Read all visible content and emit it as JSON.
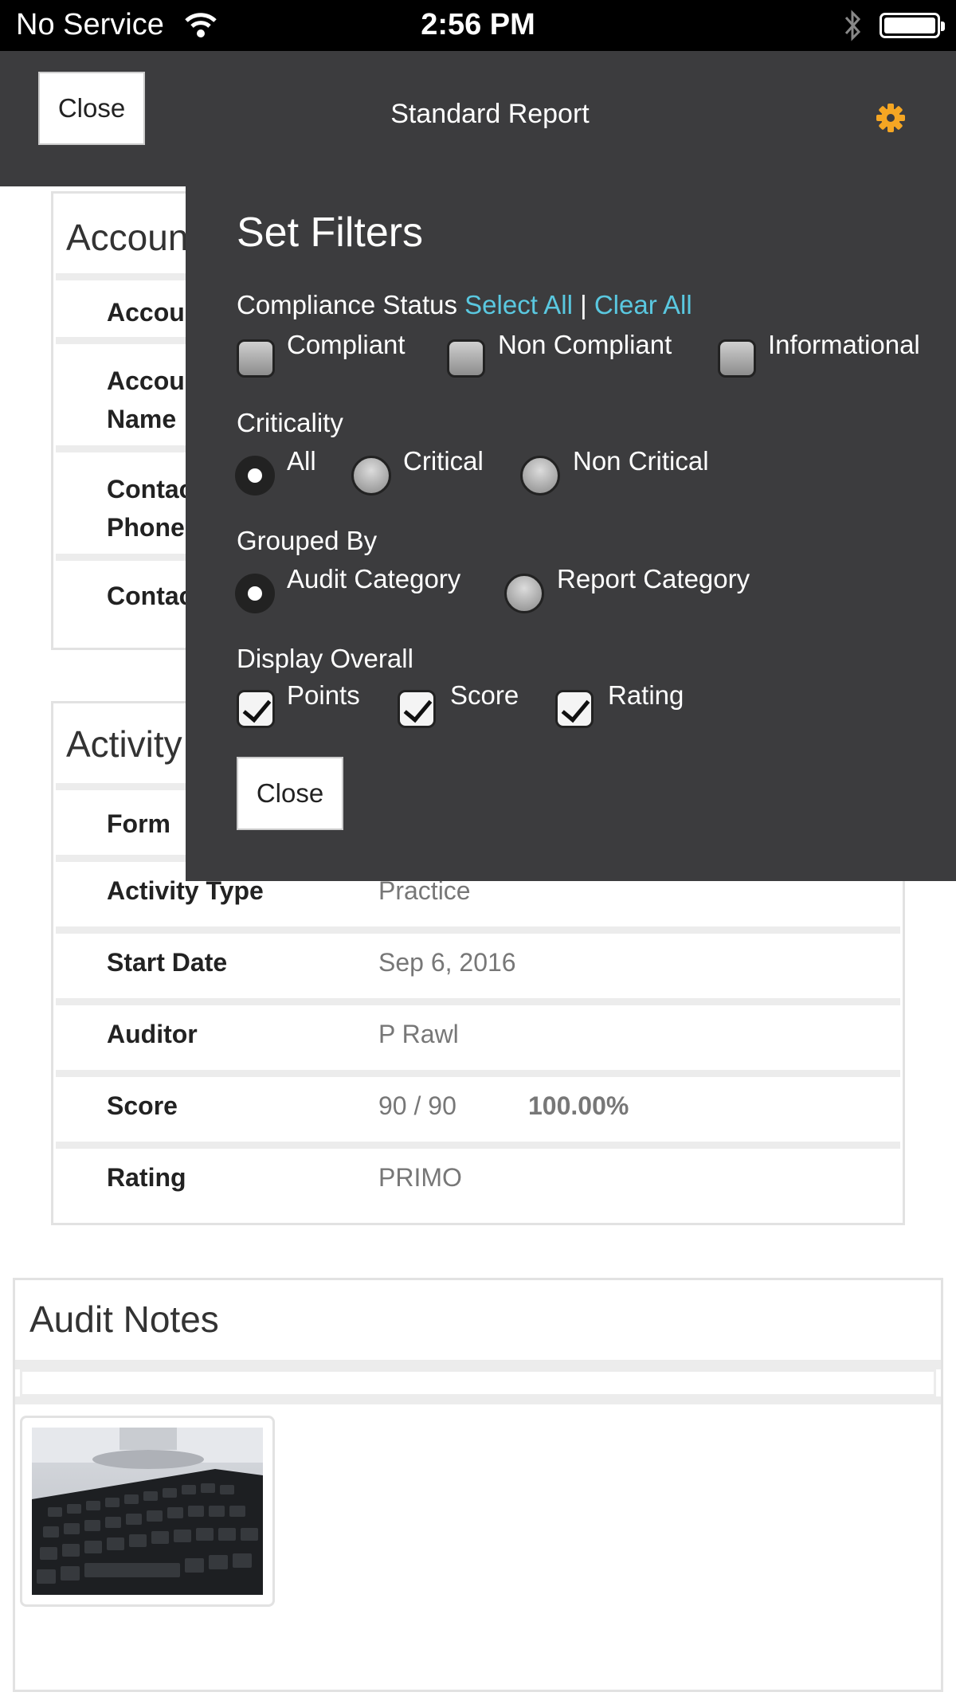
{
  "status_bar": {
    "carrier": "No Service",
    "time": "2:56 PM"
  },
  "nav": {
    "close_label": "Close",
    "title": "Standard Report",
    "gear_color": "#f5a623"
  },
  "account_panel": {
    "title": "Account",
    "rows": [
      {
        "label": "Account"
      },
      {
        "label": "Account\nName"
      },
      {
        "label": "Contact\nPhone"
      },
      {
        "label": "Contact"
      }
    ]
  },
  "activity_panel": {
    "title": "Activity",
    "rows": [
      {
        "label": "Form",
        "value": ""
      },
      {
        "label": "Activity Type",
        "value": "Practice"
      },
      {
        "label": "Start Date",
        "value": "Sep 6, 2016"
      },
      {
        "label": "Auditor",
        "value": "P Rawl"
      },
      {
        "label": "Score",
        "value": "90 / 90",
        "percent": "100.00%"
      },
      {
        "label": "Rating",
        "value": "PRIMO"
      }
    ]
  },
  "audit_notes": {
    "title": "Audit Notes"
  },
  "filters": {
    "title": "Set Filters",
    "compliance": {
      "label": "Compliance Status",
      "select_all": "Select All",
      "separator": "|",
      "clear_all": "Clear All",
      "options": [
        {
          "label": "Compliant",
          "checked": false
        },
        {
          "label": "Non Compliant",
          "checked": false
        },
        {
          "label": "Informational",
          "checked": false
        }
      ]
    },
    "criticality": {
      "label": "Criticality",
      "options": [
        {
          "label": "All",
          "selected": true
        },
        {
          "label": "Critical",
          "selected": false
        },
        {
          "label": "Non Critical",
          "selected": false
        }
      ]
    },
    "grouped_by": {
      "label": "Grouped By",
      "options": [
        {
          "label": "Audit Category",
          "selected": true
        },
        {
          "label": "Report Category",
          "selected": false
        }
      ]
    },
    "display_overall": {
      "label": "Display Overall",
      "options": [
        {
          "label": "Points",
          "checked": true
        },
        {
          "label": "Score",
          "checked": true
        },
        {
          "label": "Rating",
          "checked": true
        }
      ]
    },
    "close_label": "Close"
  },
  "colors": {
    "overlay_bg": "#3c3c3e",
    "link": "#5ac8e0",
    "accent": "#f5a623"
  }
}
